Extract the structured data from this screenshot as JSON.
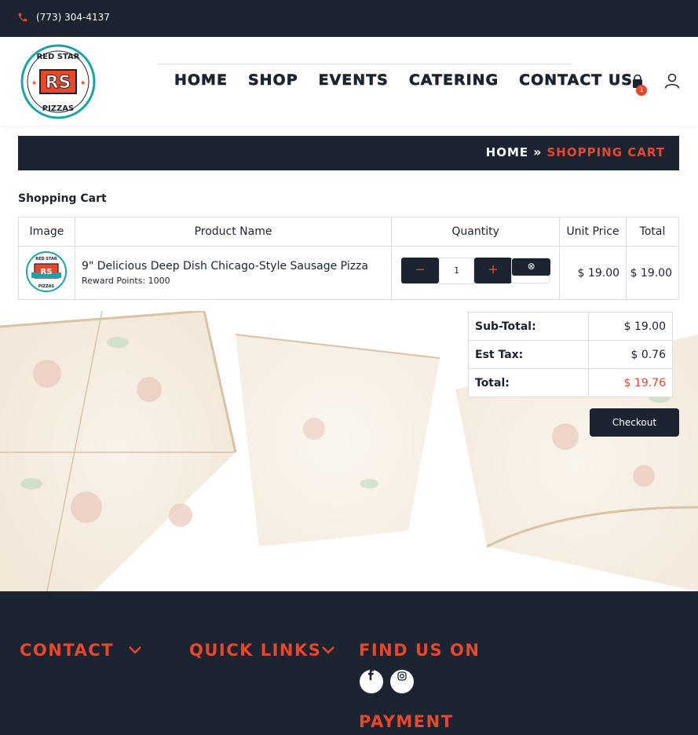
{
  "topbar": {
    "phone": "(773) 304-4137",
    "phone_icon": "phone-icon"
  },
  "header": {
    "logo_alt": "Red Star Pizzas logo",
    "nav": [
      {
        "label": "HOME"
      },
      {
        "label": "SHOP"
      },
      {
        "label": "EVENTS"
      },
      {
        "label": "CATERING"
      },
      {
        "label": "CONTACT US"
      }
    ],
    "cart_count": "1",
    "cart_icon": "shopping-bag-icon",
    "user_icon": "user-icon"
  },
  "breadcrumb": {
    "home": "HOME",
    "separator": "»",
    "current": "SHOPPING CART"
  },
  "page": {
    "title": "Shopping Cart"
  },
  "cart": {
    "columns": {
      "image": "Image",
      "name": "Product Name",
      "quantity": "Quantity",
      "unit_price": "Unit Price",
      "total": "Total"
    },
    "items": [
      {
        "name": "9\" Delicious Deep Dish Chicago-Style Sausage Pizza",
        "reward_points": "Reward Points: 1000",
        "quantity": "1",
        "unit_price": "$ 19.00",
        "total": "$ 19.00"
      }
    ],
    "minus_label": "−",
    "plus_label": "+",
    "remove_label": "⊗"
  },
  "totals": {
    "subtotal_label": "Sub-Total:",
    "subtotal": "$ 19.00",
    "tax_label": "Est Tax:",
    "tax": "$ 0.76",
    "total_label": "Total:",
    "total": "$ 19.76"
  },
  "checkout_label": "Checkout",
  "footer": {
    "contact": "CONTACT",
    "quick_links": "QUICK LINKS",
    "find_us": "FIND US ON",
    "payment": "PAYMENT",
    "social_icons": [
      "facebook-icon",
      "instagram-icon"
    ]
  },
  "colors": {
    "navy": "#1c2331",
    "accent": "#e8472c"
  }
}
